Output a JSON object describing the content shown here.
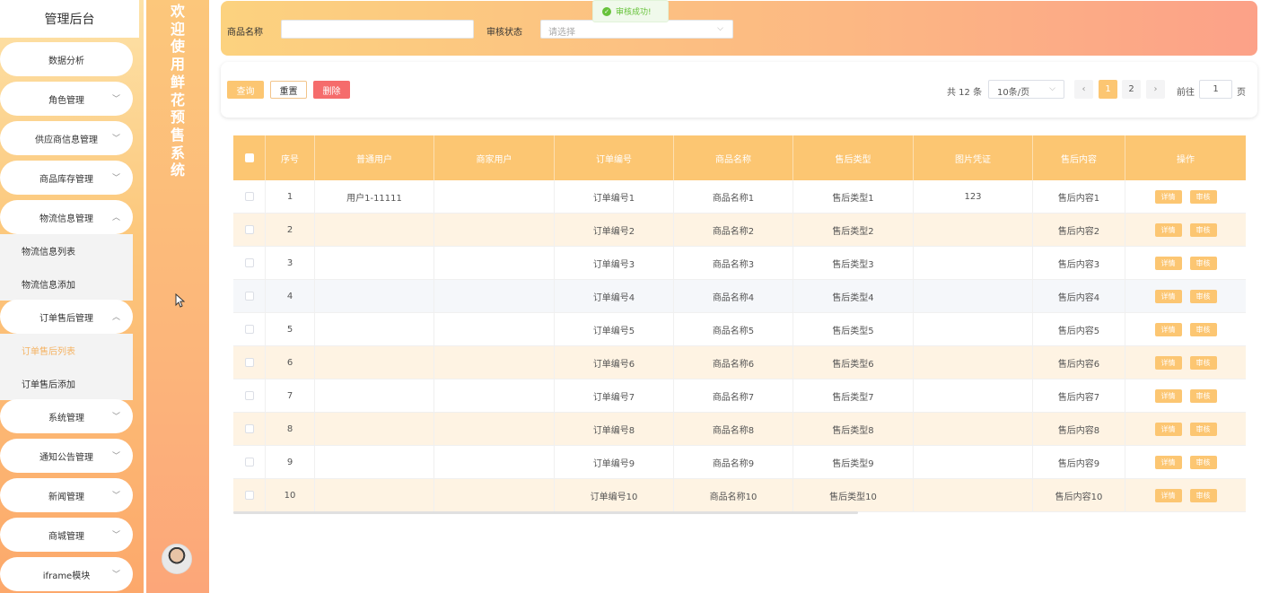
{
  "sidebar": {
    "title": "管理后台",
    "menu": [
      {
        "label": "数据分析"
      },
      {
        "label": "角色管理"
      },
      {
        "label": "供应商信息管理"
      },
      {
        "label": "商品库存管理"
      },
      {
        "label": "物流信息管理",
        "sub": [
          "物流信息列表",
          "物流信息添加"
        ]
      },
      {
        "label": "订单售后管理",
        "sub": [
          "订单售后列表",
          "订单售后添加"
        ]
      },
      {
        "label": "系统管理"
      },
      {
        "label": "通知公告管理"
      },
      {
        "label": "新闻管理"
      },
      {
        "label": "商城管理"
      },
      {
        "label": "iframe模块"
      }
    ]
  },
  "banner": {
    "text": "欢迎使用鲜花预售系统"
  },
  "filter": {
    "name_label": "商品名称",
    "name_value": "",
    "status_label": "审核状态",
    "status_placeholder": "请选择"
  },
  "toast": {
    "text": "审核成功!",
    "color": "#67c23a"
  },
  "actions": {
    "query": "查询",
    "reset": "重置",
    "delete": "删除"
  },
  "pagination": {
    "total": "共 12 条",
    "page_size": "10条/页",
    "prev": "‹",
    "next": "›",
    "pages": [
      "1",
      "2"
    ],
    "current": "1",
    "goto_label": "前往",
    "goto_value": "1",
    "page_suffix": "页"
  },
  "table": {
    "headers": [
      "序号",
      "普通用户",
      "商家用户",
      "订单编号",
      "商品名称",
      "售后类型",
      "图片凭证",
      "售后内容",
      "操作"
    ],
    "detail_label": "详情",
    "audit_label": "审核",
    "rows": [
      [
        "1",
        "用户1-11111",
        "",
        "订单编号1",
        "商品名称1",
        "售后类型1",
        "123",
        "售后内容1"
      ],
      [
        "2",
        "",
        "",
        "订单编号2",
        "商品名称2",
        "售后类型2",
        "",
        "售后内容2"
      ],
      [
        "3",
        "",
        "",
        "订单编号3",
        "商品名称3",
        "售后类型3",
        "",
        "售后内容3"
      ],
      [
        "4",
        "",
        "",
        "订单编号4",
        "商品名称4",
        "售后类型4",
        "",
        "售后内容4"
      ],
      [
        "5",
        "",
        "",
        "订单编号5",
        "商品名称5",
        "售后类型5",
        "",
        "售后内容5"
      ],
      [
        "6",
        "",
        "",
        "订单编号6",
        "商品名称6",
        "售后类型6",
        "",
        "售后内容6"
      ],
      [
        "7",
        "",
        "",
        "订单编号7",
        "商品名称7",
        "售后类型7",
        "",
        "售后内容7"
      ],
      [
        "8",
        "",
        "",
        "订单编号8",
        "商品名称8",
        "售后类型8",
        "",
        "售后内容8"
      ],
      [
        "9",
        "",
        "",
        "订单编号9",
        "商品名称9",
        "售后类型9",
        "",
        "售后内容9"
      ],
      [
        "10",
        "",
        "",
        "订单编号10",
        "商品名称10",
        "售后类型10",
        "",
        "售后内容10"
      ]
    ]
  },
  "colors": {
    "accent": "#fcc672",
    "danger": "#f56c6c",
    "stripe": "#fef3e3"
  }
}
